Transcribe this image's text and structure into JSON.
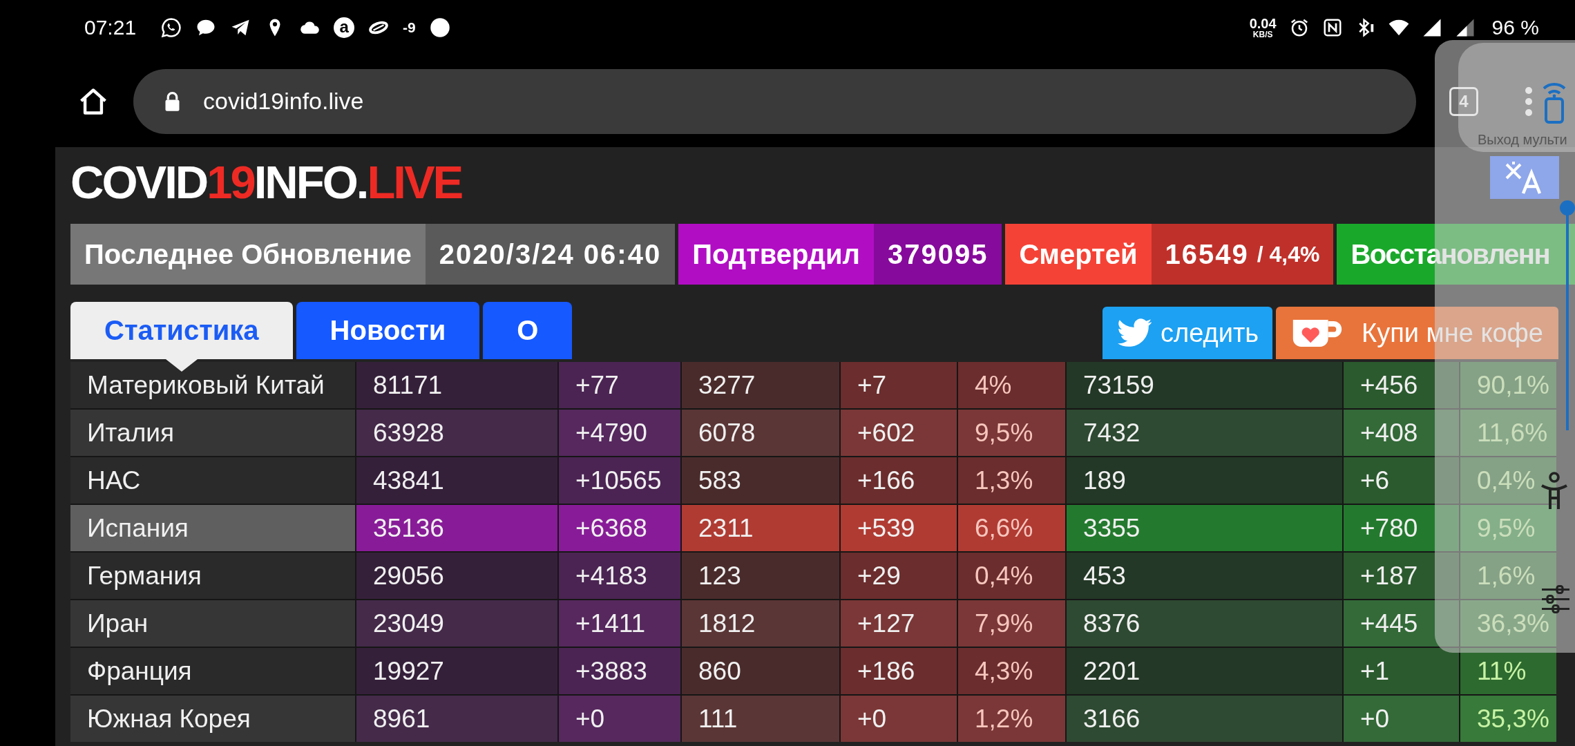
{
  "status_bar": {
    "time": "07:21",
    "app_letter": "a",
    "notification_text": "-9",
    "network_speed": "0.04",
    "network_unit": "KB/S",
    "battery": "96 %"
  },
  "browser": {
    "url": "covid19info.live",
    "tab_count": "4"
  },
  "logo": [
    {
      "text": "COVID",
      "accent": false
    },
    {
      "text": "19",
      "accent": true
    },
    {
      "text": "INFO.",
      "accent": false
    },
    {
      "text": "LIVE",
      "accent": true
    }
  ],
  "summary": [
    {
      "kind": "update",
      "label": "Последнее Обновление",
      "value": "2020/3/24 06:40"
    },
    {
      "kind": "confirmed",
      "label": "Подтвердил",
      "value": "379095"
    },
    {
      "kind": "deaths",
      "label": "Смертей",
      "value": "16549",
      "rate": "/ 4,4%"
    },
    {
      "kind": "recovered",
      "label": "Восстановленн"
    }
  ],
  "tabs": [
    {
      "label": "Статистика",
      "selected": true
    },
    {
      "label": "Новости",
      "selected": false
    },
    {
      "label": "О",
      "selected": false
    }
  ],
  "share_buttons": [
    {
      "kind": "twitter",
      "label": "следить"
    },
    {
      "kind": "coffee",
      "label": "Купи мне кофе"
    }
  ],
  "table": {
    "rows": [
      {
        "selected": false,
        "cells": [
          "Материковый Китай",
          "81171",
          "+77",
          "3277",
          "+7",
          "4%",
          "73159",
          "+456",
          "90,1%"
        ]
      },
      {
        "selected": false,
        "cells": [
          "Италия",
          "63928",
          "+4790",
          "6078",
          "+602",
          "9,5%",
          "7432",
          "+408",
          "11,6%"
        ]
      },
      {
        "selected": false,
        "cells": [
          "НАС",
          "43841",
          "+10565",
          "583",
          "+166",
          "1,3%",
          "189",
          "+6",
          "0,4%"
        ]
      },
      {
        "selected": true,
        "cells": [
          "Испания",
          "35136",
          "+6368",
          "2311",
          "+539",
          "6,6%",
          "3355",
          "+780",
          "9,5%"
        ]
      },
      {
        "selected": false,
        "cells": [
          "Германия",
          "29056",
          "+4183",
          "123",
          "+29",
          "0,4%",
          "453",
          "+187",
          "1,6%"
        ]
      },
      {
        "selected": false,
        "cells": [
          "Иран",
          "23049",
          "+1411",
          "1812",
          "+127",
          "7,9%",
          "8376",
          "+445",
          "36,3%"
        ]
      },
      {
        "selected": false,
        "cells": [
          "Франция",
          "19927",
          "+3883",
          "860",
          "+186",
          "4,3%",
          "2201",
          "+1",
          "11%"
        ]
      },
      {
        "selected": false,
        "cells": [
          "Южная Корея",
          "8961",
          "+0",
          "111",
          "+0",
          "1,2%",
          "3166",
          "+0",
          "35,3%"
        ]
      }
    ]
  },
  "overlay_panel": {
    "exit_label": "Выход мульти",
    "slider": {
      "level": 1
    }
  }
}
